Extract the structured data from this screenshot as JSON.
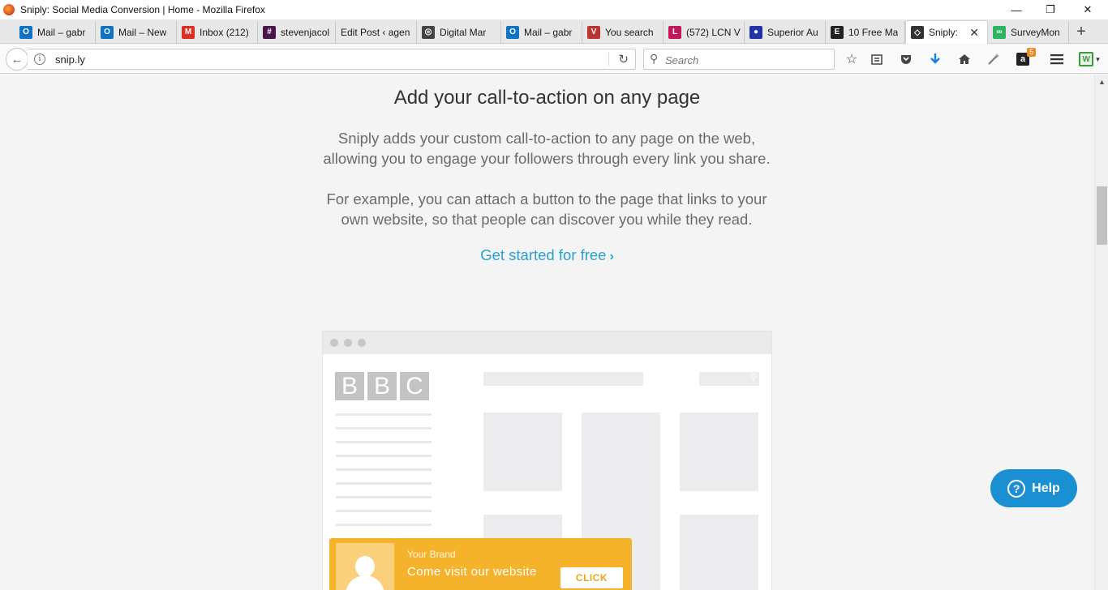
{
  "window": {
    "title": "Sniply: Social Media Conversion | Home - Mozilla Firefox",
    "minimize": "—",
    "restore": "❐",
    "close": "✕"
  },
  "tabs": [
    {
      "label": "Mail – gabr",
      "icon": "outlook-icon",
      "color": "#1072c2",
      "glyph": "O"
    },
    {
      "label": "Mail – New",
      "icon": "outlook-icon",
      "color": "#1072c2",
      "glyph": "O"
    },
    {
      "label": "Inbox (212)",
      "icon": "gmail-icon",
      "color": "#d93025",
      "glyph": "M"
    },
    {
      "label": "stevenjacol",
      "icon": "slack-icon",
      "color": "#4a154b",
      "glyph": "#"
    },
    {
      "label": "Edit Post ‹ agen",
      "icon": "",
      "color": "",
      "glyph": ""
    },
    {
      "label": "Digital Mar",
      "icon": "wordpress-icon",
      "color": "#444",
      "glyph": "◎"
    },
    {
      "label": "Mail – gabr",
      "icon": "outlook-icon",
      "color": "#1072c2",
      "glyph": "O"
    },
    {
      "label": "You search",
      "icon": "v-icon",
      "color": "#b33",
      "glyph": "V"
    },
    {
      "label": "(572) LCN V",
      "icon": "lcn-icon",
      "color": "#c2185b",
      "glyph": "L"
    },
    {
      "label": "Superior Au",
      "icon": "globe-icon",
      "color": "#2233aa",
      "glyph": "●"
    },
    {
      "label": "10 Free Ma",
      "icon": "e-icon",
      "color": "#222",
      "glyph": "E"
    },
    {
      "label": "Sniply:",
      "icon": "sniply-icon",
      "color": "#333",
      "glyph": "◇",
      "active": true
    },
    {
      "label": "SurveyMon",
      "icon": "surveymonkey-icon",
      "color": "#2fb463",
      "glyph": "∞"
    }
  ],
  "newtab": "+",
  "nav": {
    "back": "←",
    "url": "snip.ly",
    "info": "i",
    "reload": "↻",
    "search_placeholder": "Search",
    "search_icon": "⚲",
    "toolbar_badge": "5"
  },
  "main": {
    "heading": "Add your call-to-action on any page",
    "para1_line1": "Sniply adds your custom call-to-action to any page on the web,",
    "para1_line2": "allowing you to engage your followers through every link you share.",
    "para2_line1": "For example, you can attach a button to the page that links to your",
    "para2_line2": "own website, so that people can discover you while they read.",
    "cta": "Get started for free",
    "cta_chevron": "›"
  },
  "mockup": {
    "logo_letters": [
      "B",
      "B",
      "C"
    ],
    "brand_name": "Your Brand",
    "brand_message": "Come visit our website",
    "click_button": "CLICK"
  },
  "help": {
    "label": "Help",
    "glyph": "?"
  },
  "colors": {
    "accent_link": "#2aa0cf",
    "brand_bar": "#f5b22b",
    "help_button": "#1a8fd1"
  }
}
